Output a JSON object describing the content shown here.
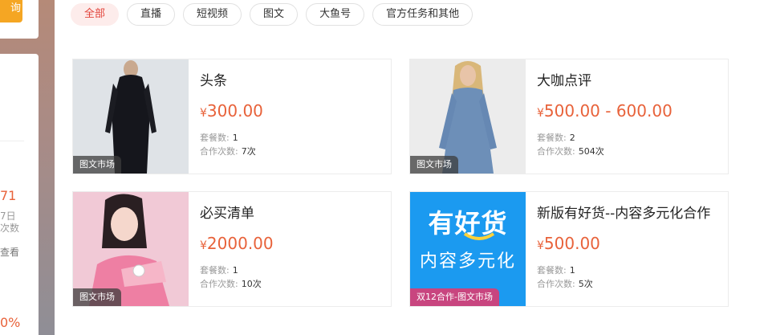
{
  "sidebar": {
    "button_label": "询",
    "stat_value": "71",
    "line1": "7日",
    "line2": "次数",
    "link": "查看",
    "percent": "0%"
  },
  "tabs": [
    {
      "label": "全部",
      "active": true
    },
    {
      "label": "直播",
      "active": false
    },
    {
      "label": "短视频",
      "active": false
    },
    {
      "label": "图文",
      "active": false
    },
    {
      "label": "大鱼号",
      "active": false
    },
    {
      "label": "官方任务和其他",
      "active": false
    }
  ],
  "labels": {
    "currency": "¥",
    "packages": "套餐数:",
    "coops": "合作次数:"
  },
  "cards": [
    {
      "title": "头条",
      "price": "300.00",
      "packages": "1",
      "coops": "7次",
      "badge": "图文市场",
      "image": "woman-black-dress-photo"
    },
    {
      "title": "大咖点评",
      "price": "500.00 - 600.00",
      "packages": "2",
      "coops": "504次",
      "badge": "图文市场",
      "image": "woman-denim-dress-photo"
    },
    {
      "title": "必买清单",
      "price": "2000.00",
      "packages": "1",
      "coops": "10次",
      "badge": "图文市场",
      "image": "woman-pink-sweater-watch-photo"
    },
    {
      "title": "新版有好货--内容多元化合作",
      "price": "500.00",
      "packages": "1",
      "coops": "5次",
      "badge": "双12合作-图文市场",
      "image": "youhaohuo-logo",
      "logo_line1": "有好货",
      "logo_line2": "内容多元化"
    }
  ],
  "colors": {
    "accent": "#e2443b",
    "price": "#e8623a",
    "logo_bg": "#1b9af0"
  }
}
